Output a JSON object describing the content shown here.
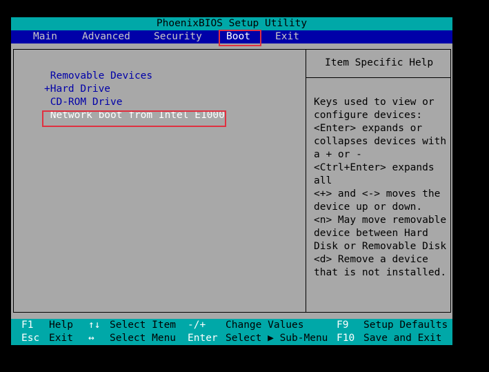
{
  "title": "PhoenixBIOS Setup Utility",
  "menu": {
    "main": "Main",
    "advanced": "Advanced",
    "security": "Security",
    "boot": "Boot",
    "exit": "Exit",
    "active": "Boot"
  },
  "boot_devices": [
    {
      "prefix": " ",
      "label": "Removable Devices"
    },
    {
      "prefix": "+",
      "label": "Hard Drive"
    },
    {
      "prefix": " ",
      "label": "CD-ROM Drive"
    },
    {
      "prefix": " ",
      "label": "Network boot from Intel E1000",
      "selected": true
    }
  ],
  "help": {
    "title": "Item Specific Help",
    "lines": [
      "Keys used to view or",
      "configure devices:",
      "<Enter> expands or",
      "collapses devices with",
      "a + or -",
      "<Ctrl+Enter> expands",
      "all",
      "<+> and <-> moves the",
      "device up or down.",
      "<n> May move removable",
      "device between Hard",
      "Disk or Removable Disk",
      "<d> Remove a device",
      "that is not installed."
    ]
  },
  "footer": {
    "row1": [
      {
        "key": "F1",
        "desc": "Help"
      },
      {
        "key": "↑↓",
        "desc": "Select Item"
      },
      {
        "key": "-/+",
        "desc": "Change Values"
      },
      {
        "key": "F9",
        "desc": "Setup Defaults"
      }
    ],
    "row2": [
      {
        "key": "Esc",
        "desc": "Exit"
      },
      {
        "key": "↔",
        "desc": "Select Menu"
      },
      {
        "key": "Enter",
        "desc": "Select ▶ Sub-Menu"
      },
      {
        "key": "F10",
        "desc": "Save and Exit"
      }
    ]
  },
  "colors": {
    "cyan": "#00a8a8",
    "blue": "#0000a8",
    "gray": "#a8a8a8",
    "highlight": "#e03040"
  }
}
